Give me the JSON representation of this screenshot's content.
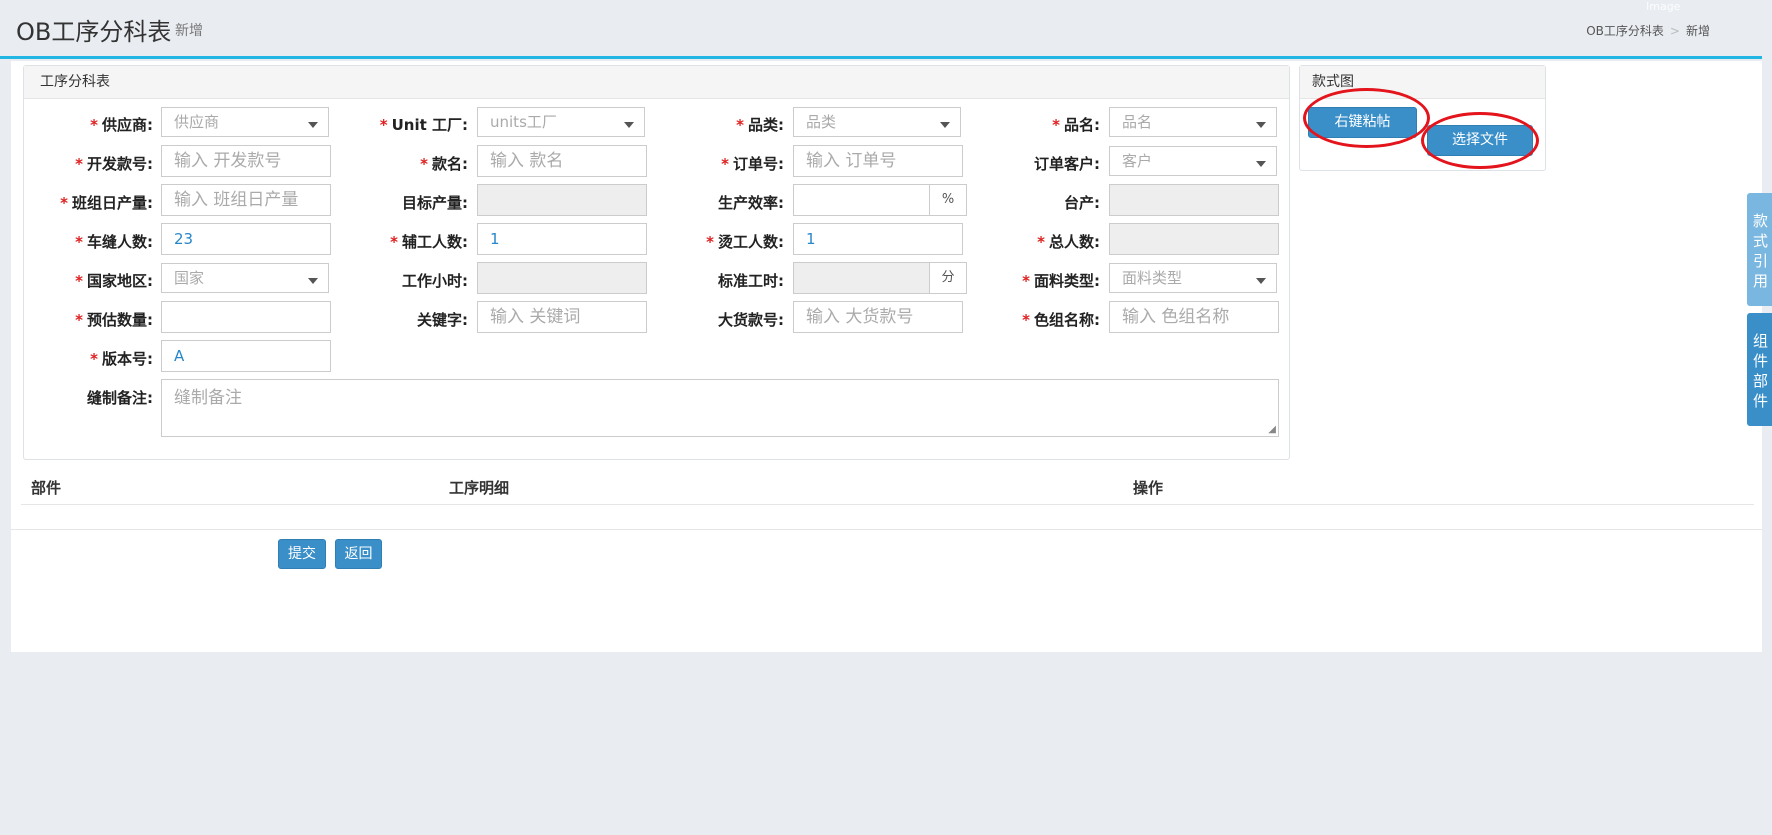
{
  "header": {
    "title": "OB工序分科表",
    "subtitle": "新增",
    "faint_label": "Image",
    "breadcrumb": [
      "OB工序分科表",
      "新增"
    ],
    "breadcrumb_sep": ">"
  },
  "main_panel": {
    "title": "工序分科表",
    "fields": {
      "supplier": {
        "label": "供应商:",
        "placeholder": "供应商"
      },
      "unit_factory": {
        "label": "Unit 工厂:",
        "placeholder": "units工厂"
      },
      "category": {
        "label": "品类:",
        "placeholder": "品类"
      },
      "product_name": {
        "label": "品名:",
        "placeholder": "品名"
      },
      "dev_style_no": {
        "label": "开发款号:",
        "placeholder": "输入 开发款号"
      },
      "style_name": {
        "label": "款名:",
        "placeholder": "输入 款名"
      },
      "order_no": {
        "label": "订单号:",
        "placeholder": "输入 订单号"
      },
      "order_customer": {
        "label": "订单客户:",
        "placeholder": "客户"
      },
      "team_daily_output": {
        "label": "班组日产量:",
        "placeholder": "输入 班组日产量"
      },
      "target_output": {
        "label": "目标产量:"
      },
      "efficiency": {
        "label": "生产效率:",
        "addon": "%"
      },
      "per_machine_output": {
        "label": "台产:"
      },
      "sewers": {
        "label": "车缝人数:",
        "value": "23"
      },
      "helpers": {
        "label": "辅工人数:",
        "value": "1"
      },
      "ironers": {
        "label": "烫工人数:",
        "value": "1"
      },
      "total_people": {
        "label": "总人数:"
      },
      "country": {
        "label": "国家地区:",
        "placeholder": "国家"
      },
      "work_hours": {
        "label": "工作小时:"
      },
      "standard_time": {
        "label": "标准工时:",
        "addon": "分"
      },
      "fabric_type": {
        "label": "面料类型:",
        "placeholder": "面料类型"
      },
      "estimated_qty": {
        "label": "预估数量:"
      },
      "keyword": {
        "label": "关键字:",
        "placeholder": "输入 关键词"
      },
      "bulk_style_no": {
        "label": "大货款号:",
        "placeholder": "输入 大货款号"
      },
      "color_group": {
        "label": "色组名称:",
        "placeholder": "输入 色组名称"
      },
      "version": {
        "label": "版本号:",
        "value": "A"
      },
      "sewing_notes": {
        "label": "缝制备注:",
        "placeholder": "缝制备注"
      }
    }
  },
  "style_panel": {
    "title": "款式图",
    "paste_button": "右键粘帖",
    "file_button": "选择文件"
  },
  "table": {
    "columns": [
      "部件",
      "工序明细",
      "操作"
    ]
  },
  "actions": {
    "submit": "提交",
    "back": "返回"
  },
  "side_tabs": {
    "style_ref": [
      "款",
      "式",
      "引",
      "用"
    ],
    "components": [
      "组",
      "件",
      "部",
      "件"
    ]
  },
  "colors": {
    "accent": "#22b6e4",
    "primary_button": "#3a8fc9",
    "required_star": "#e02020",
    "annotation_circle": "#e3141b",
    "side_tab_light": "#7ab7e0",
    "side_tab_dark": "#3a8fc9"
  }
}
